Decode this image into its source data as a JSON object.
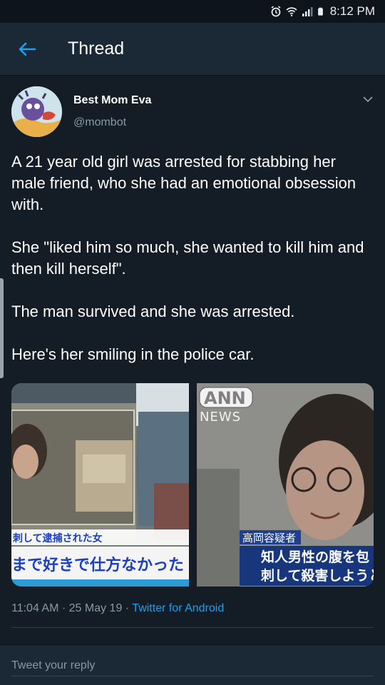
{
  "status_bar": {
    "time": "8:12 PM",
    "icons": [
      "alarm-icon",
      "wifi-icon",
      "signal-icon",
      "battery-icon"
    ]
  },
  "header": {
    "title": "Thread",
    "back_icon": "arrow-left-icon",
    "accent_color": "#1da1f2"
  },
  "tweet": {
    "display_name": "Best Mom Eva",
    "handle": "@mombot",
    "paragraphs": [
      "A 21 year old girl was arrested for stabbing her male friend, who she had an emotional obsession with.",
      "She \"liked him so much, she wanted to kill him and then kill herself\".",
      "The man survived and she was arrested.",
      "Here's her smiling in the police car."
    ],
    "media": {
      "left": {
        "caption_top": "刺して逮捕された女",
        "caption_bottom": "まで好きで仕方なかった"
      },
      "right": {
        "logo_top": "ANN",
        "logo_bottom": "NEWS",
        "tag": "高岡容疑者",
        "caption_line1": "知人男性の腹を包",
        "caption_line2": "刺して殺害しようとし"
      }
    },
    "meta": {
      "time": "11:04 AM",
      "sep1": " · ",
      "date": "25 May 19",
      "sep2": " · ",
      "client": "Twitter for Android"
    }
  },
  "reply": {
    "placeholder": "Tweet your reply"
  }
}
